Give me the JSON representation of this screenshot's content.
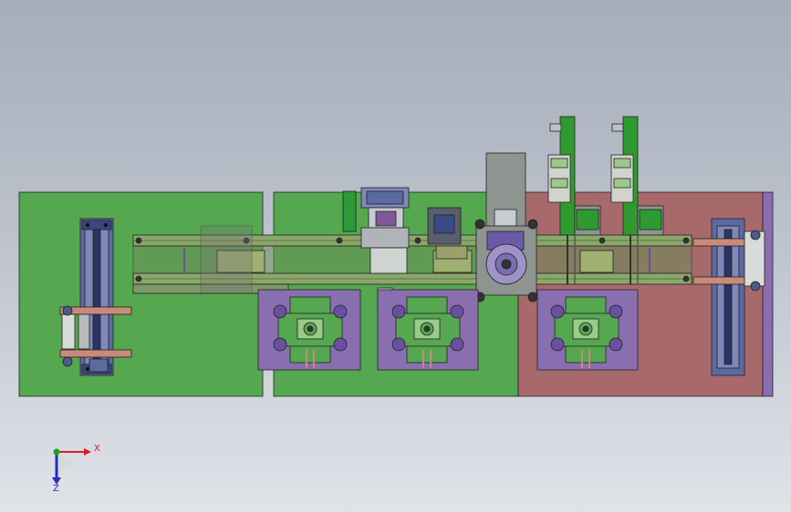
{
  "viewport": {
    "background": "gradient-grey",
    "colors": {
      "plate_green": "#55a850",
      "plate_red": "#a8696b",
      "fixture_purple": "#8a6fb0",
      "rail_green": "#8aa86a",
      "motor_grey": "#8e9590",
      "belt_green": "#2f9a2f",
      "cylinder_blue": "#5b6aa0",
      "edge": "#222222"
    }
  },
  "triad": {
    "x_label": "X",
    "z_label": "Z",
    "x_color": "#d42020",
    "y_color": "#20a020",
    "z_color": "#2030c0"
  },
  "model": {
    "base_plates": 3,
    "nest_fixtures": 3,
    "vertical_modules": 2,
    "icon": "assembly-model-icon"
  }
}
